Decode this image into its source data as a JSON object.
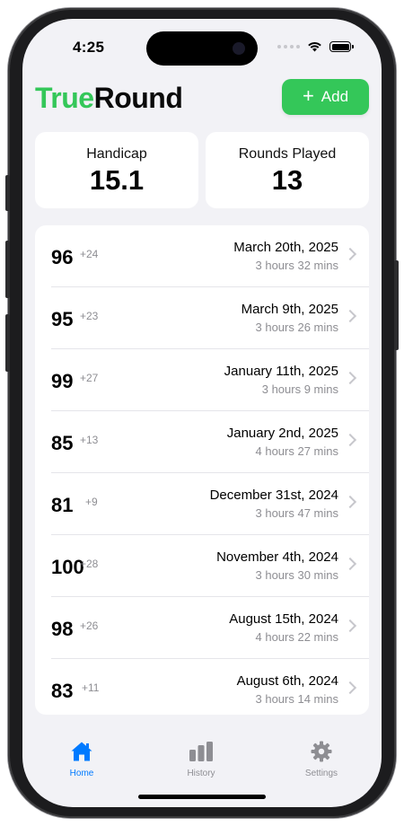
{
  "status_bar": {
    "time": "4:25"
  },
  "header": {
    "brand_part1": "True",
    "brand_part2": "Round",
    "add_button": {
      "icon": "plus-icon",
      "label": "Add"
    }
  },
  "stats": [
    {
      "label": "Handicap",
      "value": "15.1"
    },
    {
      "label": "Rounds Played",
      "value": "13"
    }
  ],
  "rounds": [
    {
      "score": "96",
      "diff": "+24",
      "date": "March 20th, 2025",
      "duration": "3 hours 32 mins"
    },
    {
      "score": "95",
      "diff": "+23",
      "date": "March 9th, 2025",
      "duration": "3 hours 26 mins"
    },
    {
      "score": "99",
      "diff": "+27",
      "date": "January 11th, 2025",
      "duration": "3 hours 9 mins"
    },
    {
      "score": "85",
      "diff": "+13",
      "date": "January 2nd, 2025",
      "duration": "4 hours 27 mins"
    },
    {
      "score": "81",
      "diff": "+9",
      "date": "December 31st, 2024",
      "duration": "3 hours 47 mins"
    },
    {
      "score": "100",
      "diff": "+28",
      "date": "November 4th, 2024",
      "duration": "3 hours 30 mins"
    },
    {
      "score": "98",
      "diff": "+26",
      "date": "August 15th, 2024",
      "duration": "4 hours 22 mins"
    },
    {
      "score": "83",
      "diff": "+11",
      "date": "August 6th, 2024",
      "duration": "3 hours 14 mins"
    }
  ],
  "tabs": [
    {
      "label": "Home",
      "icon": "house-icon",
      "active": true
    },
    {
      "label": "History",
      "icon": "bar-chart-icon",
      "active": false
    },
    {
      "label": "Settings",
      "icon": "gear-icon",
      "active": false
    }
  ],
  "colors": {
    "accent": "#34c759",
    "tab_active": "#007aff",
    "tab_inactive": "#8e8e93",
    "background": "#f2f2f6"
  }
}
